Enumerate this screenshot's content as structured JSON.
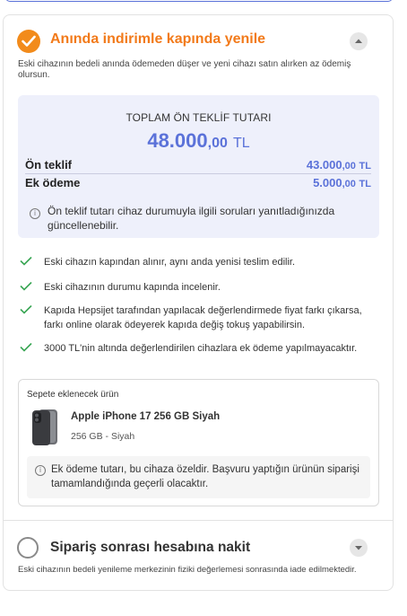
{
  "option_instant": {
    "title": "Anında indirimle kapında yenile",
    "description": "Eski cihazının bedeli anında ödemeden düşer ve yeni cihazı satın alırken az ödemiş olursun.",
    "offer": {
      "title": "TOPLAM ÖN TEKLİF TUTARI",
      "total_int": "48.000",
      "total_dec": ",00",
      "currency": "TL",
      "rows": [
        {
          "label": "Ön teklif",
          "int": "43.000",
          "dec": ",00",
          "currency": "TL"
        },
        {
          "label": "Ek ödeme",
          "int": "5.000",
          "dec": ",00",
          "currency": "TL"
        }
      ],
      "note": "Ön teklif tutarı cihaz durumuyla ilgili soruları yanıtladığınızda güncellenebilir."
    },
    "benefits": [
      "Eski cihazın kapından alınır, aynı anda yenisi teslim edilir.",
      "Eski cihazının durumu kapında incelenir.",
      "Kapıda Hepsijet tarafından yapılacak değerlendirmede fiyat farkı çıkarsa, farkı online olarak ödeyerek kapıda değiş tokuş yapabilirsin.",
      "3000 TL'nin altında değerlendirilen cihazlara ek ödeme yapılmayacaktır."
    ],
    "product": {
      "heading": "Sepete eklenecek ürün",
      "name": "Apple iPhone 17 256 GB Siyah",
      "sub": "256 GB - Siyah",
      "note": "Ek ödeme tutarı, bu cihaza özeldir. Başvuru yaptığın ürünün siparişi tamamlandığında geçerli olacaktır."
    }
  },
  "option_cash": {
    "title": "Sipariş sonrası hesabına nakit",
    "description": "Eski cihazının bedeli yenileme merkezinin fiziki değerlemesi sonrasında iade edilmektedir."
  },
  "colors": {
    "accent_orange": "#f27a1a",
    "accent_blue": "#5b72d9",
    "check_green": "#3aa655"
  },
  "icons": [
    "check-icon",
    "chevron-up-icon",
    "chevron-down-icon",
    "info-icon",
    "checkmark-icon",
    "phone-image"
  ]
}
